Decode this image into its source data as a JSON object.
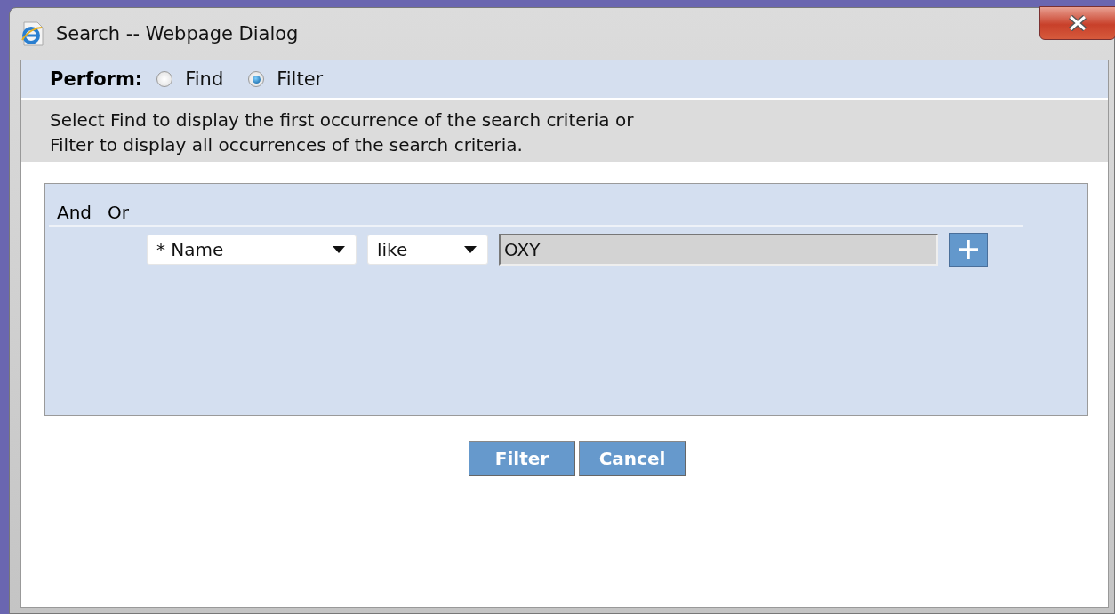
{
  "window": {
    "title": "Search -- Webpage Dialog"
  },
  "perform": {
    "label": "Perform:",
    "options": [
      {
        "label": "Find",
        "selected": false
      },
      {
        "label": "Filter",
        "selected": true
      }
    ]
  },
  "info": [
    "Select Find to display the first occurrence of the search criteria or",
    "Filter to display all occurrences of the search criteria."
  ],
  "criteria": {
    "logic": [
      "And",
      "Or"
    ],
    "rows": [
      {
        "field": "* Name",
        "operator": "like",
        "value": "OXY"
      }
    ]
  },
  "buttons": [
    "Filter",
    "Cancel"
  ]
}
